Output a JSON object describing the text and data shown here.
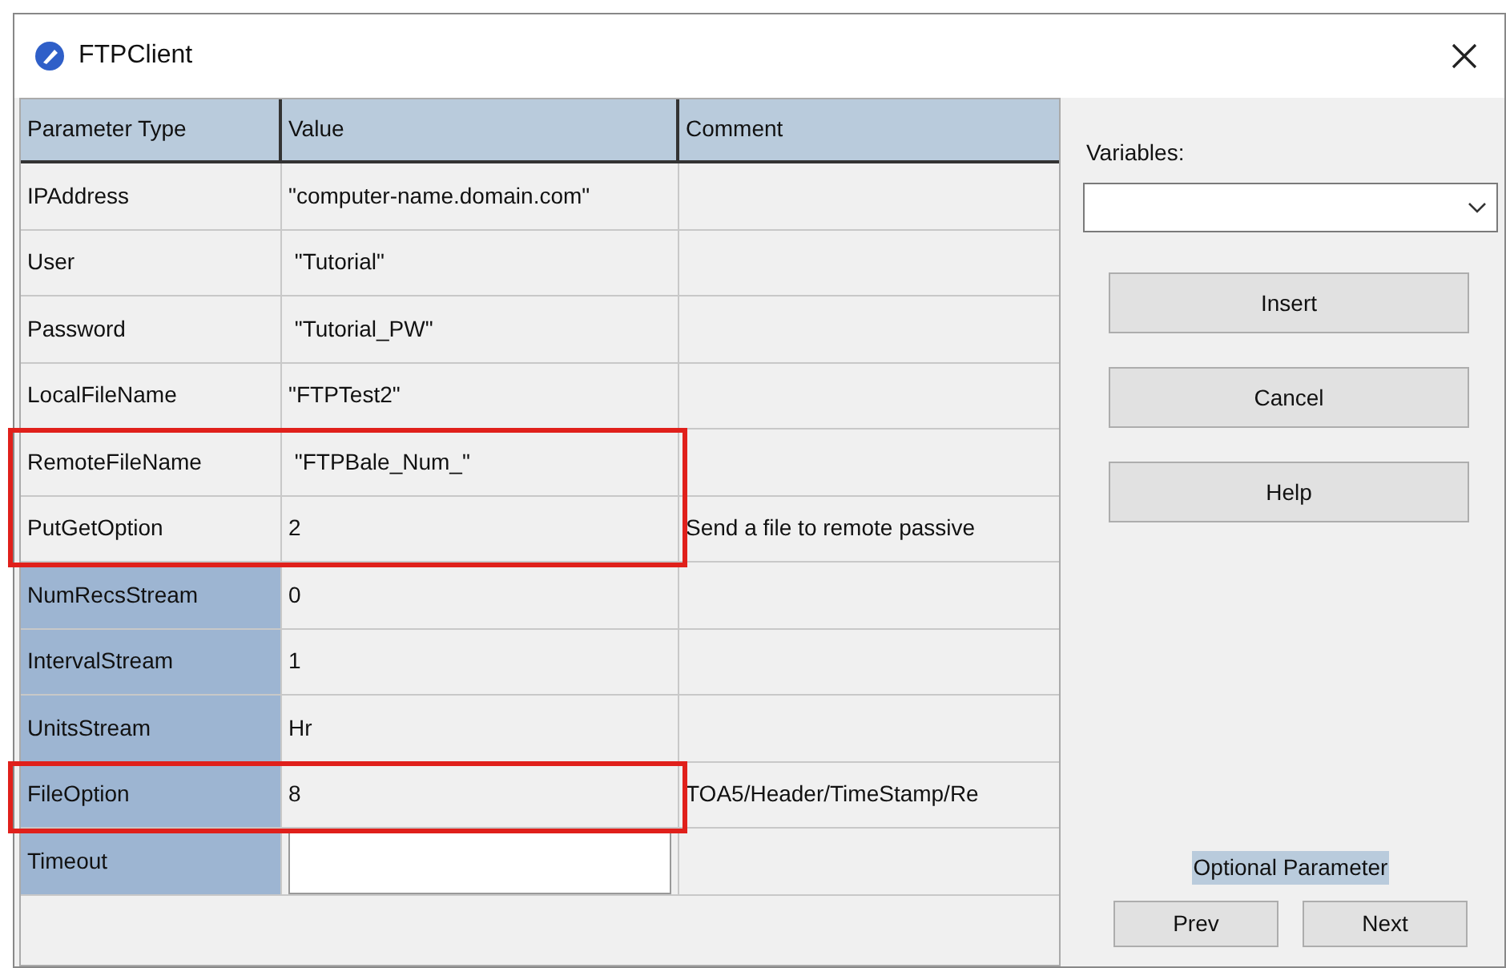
{
  "window": {
    "title": "FTPClient"
  },
  "table": {
    "columns": [
      "Parameter Type",
      "Value",
      "Comment"
    ],
    "rows": [
      {
        "parameter": "IPAddress",
        "value": "\"computer-name.domain.com\"",
        "comment": "",
        "optional": false,
        "highlighted": false,
        "editing": false
      },
      {
        "parameter": "User",
        "value": " \"Tutorial\"",
        "comment": "",
        "optional": false,
        "highlighted": false,
        "editing": false
      },
      {
        "parameter": "Password",
        "value": " \"Tutorial_PW\"",
        "comment": "",
        "optional": false,
        "highlighted": false,
        "editing": false
      },
      {
        "parameter": "LocalFileName",
        "value": "\"FTPTest2\"",
        "comment": "",
        "optional": false,
        "highlighted": false,
        "editing": false
      },
      {
        "parameter": "RemoteFileName",
        "value": " \"FTPBale_Num_\"",
        "comment": "",
        "optional": false,
        "highlighted": true,
        "editing": false
      },
      {
        "parameter": "PutGetOption",
        "value": "2",
        "comment": "Send a file to remote passive",
        "optional": false,
        "highlighted": true,
        "editing": false
      },
      {
        "parameter": "NumRecsStream",
        "value": "0",
        "comment": "",
        "optional": true,
        "highlighted": false,
        "editing": false
      },
      {
        "parameter": "IntervalStream",
        "value": "1",
        "comment": "",
        "optional": true,
        "highlighted": false,
        "editing": false
      },
      {
        "parameter": "UnitsStream",
        "value": "Hr",
        "comment": "",
        "optional": true,
        "highlighted": false,
        "editing": false
      },
      {
        "parameter": "FileOption",
        "value": "8",
        "comment": "TOA5/Header/TimeStamp/Re",
        "optional": true,
        "highlighted": true,
        "editing": false
      },
      {
        "parameter": "Timeout",
        "value": "",
        "comment": "",
        "optional": true,
        "highlighted": false,
        "editing": true
      }
    ]
  },
  "side_panel": {
    "variables_label": "Variables:",
    "buttons": [
      "Insert",
      "Cancel",
      "Help"
    ],
    "status": "Optional Parameter",
    "nav_buttons": [
      "Prev",
      "Next"
    ]
  }
}
